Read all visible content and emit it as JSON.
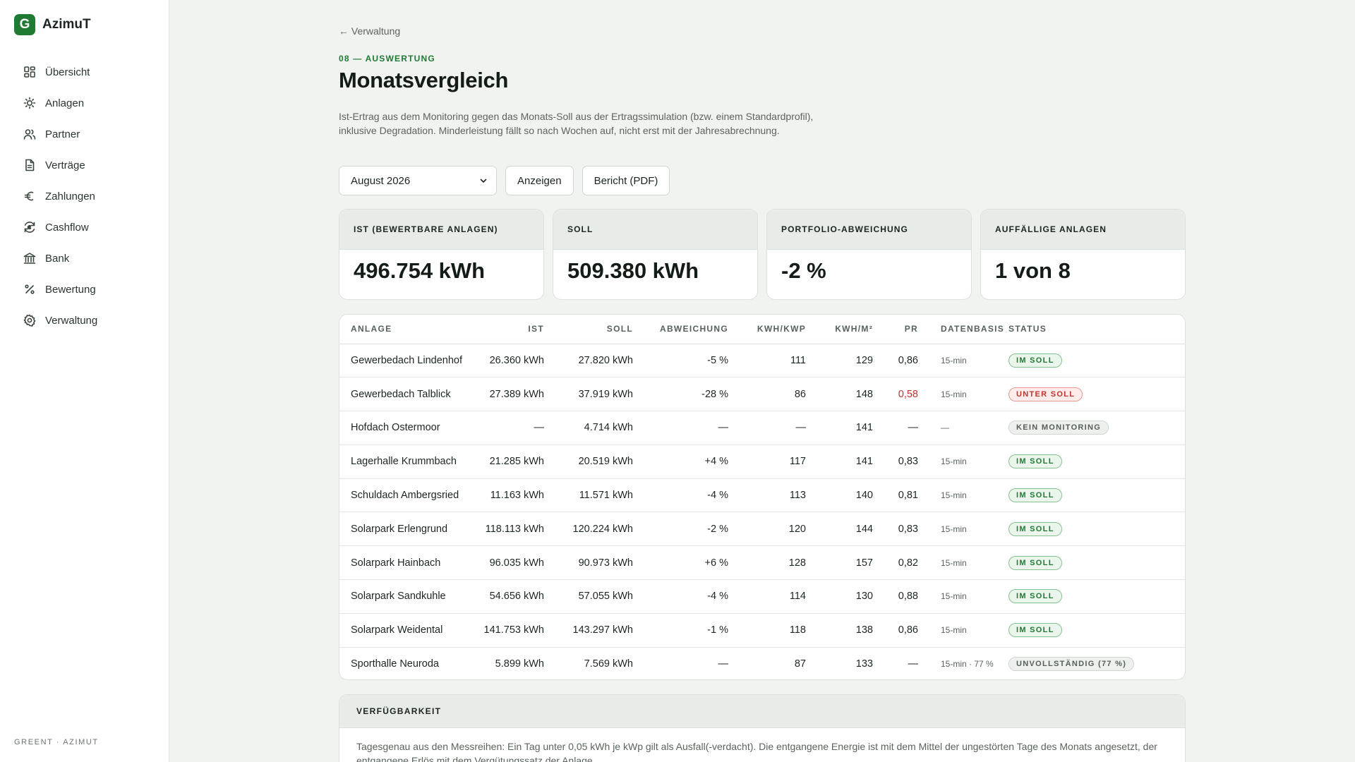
{
  "brand": {
    "logo_letter": "G",
    "name": "AzimuT"
  },
  "sidebar": {
    "items": [
      {
        "label": "Übersicht",
        "icon": "grid-icon"
      },
      {
        "label": "Anlagen",
        "icon": "sun-icon"
      },
      {
        "label": "Partner",
        "icon": "users-icon"
      },
      {
        "label": "Verträge",
        "icon": "document-icon"
      },
      {
        "label": "Zahlungen",
        "icon": "euro-icon"
      },
      {
        "label": "Cashflow",
        "icon": "cashflow-icon"
      },
      {
        "label": "Bank",
        "icon": "bank-icon"
      },
      {
        "label": "Bewertung",
        "icon": "percent-icon"
      },
      {
        "label": "Verwaltung",
        "icon": "gear-icon"
      }
    ],
    "footer": "GREENT · AZIMUT"
  },
  "header": {
    "back_label": "← Verwaltung",
    "eyebrow": "08 — AUSWERTUNG",
    "title": "Monatsvergleich",
    "intro": "Ist-Ertrag aus dem Monitoring gegen das Monats-Soll aus der Ertragssimulation (bzw. einem Standardprofil), inklusive Degradation. Minderleistung fällt so nach Wochen auf, nicht erst mit der Jahresabrechnung."
  },
  "controls": {
    "month_select": "August 2026",
    "show_button": "Anzeigen",
    "report_button": "Bericht (PDF)"
  },
  "kpis": [
    {
      "label": "IST (BEWERTBARE ANLAGEN)",
      "value": "496.754 kWh"
    },
    {
      "label": "SOLL",
      "value": "509.380 kWh"
    },
    {
      "label": "PORTFOLIO-ABWEICHUNG",
      "value": "-2 %"
    },
    {
      "label": "AUFFÄLLIGE ANLAGEN",
      "value": "1 von 8"
    }
  ],
  "table": {
    "headers": [
      "ANLAGE",
      "IST",
      "SOLL",
      "ABWEICHUNG",
      "KWH/KWP",
      "KWH/M²",
      "PR",
      "DATENBASIS",
      "STATUS"
    ],
    "rows": [
      {
        "anlage": "Gewerbedach Lindenhof",
        "ist": "26.360 kWh",
        "soll": "27.820 kWh",
        "abw": "-5 %",
        "kwp": "111",
        "m2": "129",
        "pr": "0,86",
        "basis": "15-min",
        "status": "IM SOLL",
        "status_type": "ok",
        "pr_alert": false
      },
      {
        "anlage": "Gewerbedach Talblick",
        "ist": "27.389 kWh",
        "soll": "37.919 kWh",
        "abw": "-28 %",
        "kwp": "86",
        "m2": "148",
        "pr": "0,58",
        "basis": "15-min",
        "status": "UNTER SOLL",
        "status_type": "bad",
        "pr_alert": true
      },
      {
        "anlage": "Hofdach Ostermoor",
        "ist": "—",
        "soll": "4.714 kWh",
        "abw": "—",
        "kwp": "—",
        "m2": "141",
        "pr": "—",
        "basis": "—",
        "status": "KEIN MONITORING",
        "status_type": "none",
        "pr_alert": false
      },
      {
        "anlage": "Lagerhalle Krummbach",
        "ist": "21.285 kWh",
        "soll": "20.519 kWh",
        "abw": "+4 %",
        "kwp": "117",
        "m2": "141",
        "pr": "0,83",
        "basis": "15-min",
        "status": "IM SOLL",
        "status_type": "ok",
        "pr_alert": false
      },
      {
        "anlage": "Schuldach Ambergsried",
        "ist": "11.163 kWh",
        "soll": "11.571 kWh",
        "abw": "-4 %",
        "kwp": "113",
        "m2": "140",
        "pr": "0,81",
        "basis": "15-min",
        "status": "IM SOLL",
        "status_type": "ok",
        "pr_alert": false
      },
      {
        "anlage": "Solarpark Erlengrund",
        "ist": "118.113 kWh",
        "soll": "120.224 kWh",
        "abw": "-2 %",
        "kwp": "120",
        "m2": "144",
        "pr": "0,83",
        "basis": "15-min",
        "status": "IM SOLL",
        "status_type": "ok",
        "pr_alert": false
      },
      {
        "anlage": "Solarpark Hainbach",
        "ist": "96.035 kWh",
        "soll": "90.973 kWh",
        "abw": "+6 %",
        "kwp": "128",
        "m2": "157",
        "pr": "0,82",
        "basis": "15-min",
        "status": "IM SOLL",
        "status_type": "ok",
        "pr_alert": false
      },
      {
        "anlage": "Solarpark Sandkuhle",
        "ist": "54.656 kWh",
        "soll": "57.055 kWh",
        "abw": "-4 %",
        "kwp": "114",
        "m2": "130",
        "pr": "0,88",
        "basis": "15-min",
        "status": "IM SOLL",
        "status_type": "ok",
        "pr_alert": false
      },
      {
        "anlage": "Solarpark Weidental",
        "ist": "141.753 kWh",
        "soll": "143.297 kWh",
        "abw": "-1 %",
        "kwp": "118",
        "m2": "138",
        "pr": "0,86",
        "basis": "15-min",
        "status": "IM SOLL",
        "status_type": "ok",
        "pr_alert": false
      },
      {
        "anlage": "Sporthalle Neuroda",
        "ist": "5.899 kWh",
        "soll": "7.569 kWh",
        "abw": "—",
        "kwp": "87",
        "m2": "133",
        "pr": "—",
        "basis": "15-min · 77 %",
        "status": "UNVOLLSTÄNDIG (77 %)",
        "status_type": "none",
        "pr_alert": false
      }
    ]
  },
  "availability": {
    "title": "VERFÜGBARKEIT",
    "text": "Tagesgenau aus den Messreihen: Ein Tag unter 0,05 kWh je kWp gilt als Ausfall(-verdacht). Die entgangene Energie ist mit dem Mittel der ungestörten Tage des Monats angesetzt, der entgangene Erlös mit dem Vergütungssatz der Anlage."
  },
  "colors": {
    "accent": "#1f7a34",
    "danger": "#c0342c",
    "background": "#f1f3f1"
  }
}
